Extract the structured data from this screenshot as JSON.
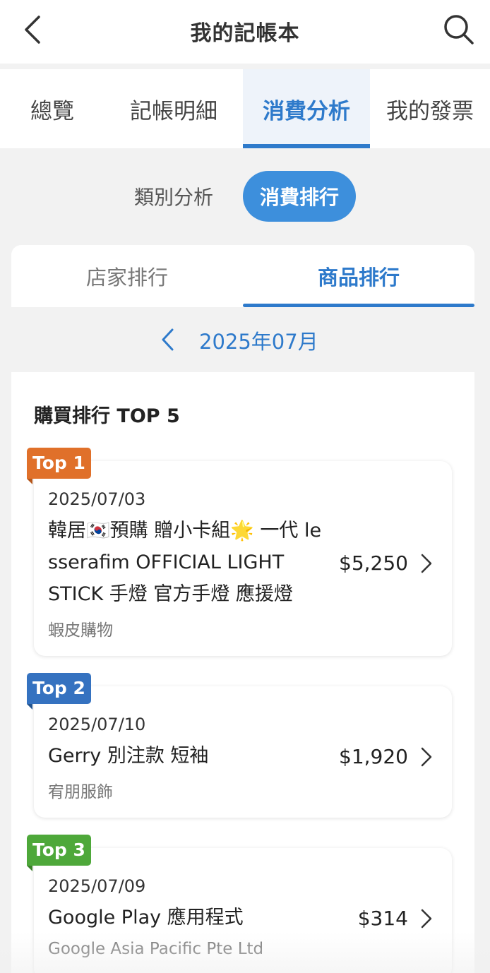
{
  "header": {
    "title": "我的記帳本",
    "back_icon": "chevron-left-icon",
    "search_icon": "search-icon"
  },
  "main_tabs": [
    {
      "label": "總覽",
      "active": false
    },
    {
      "label": "記帳明細",
      "active": false
    },
    {
      "label": "消費分析",
      "active": true
    },
    {
      "label": "我的發票",
      "active": false
    }
  ],
  "segment": {
    "category_label": "類別分析",
    "ranking_label": "消費排行",
    "active": "消費排行"
  },
  "sub_tabs": [
    {
      "label": "店家排行",
      "active": false
    },
    {
      "label": "商品排行",
      "active": true
    }
  ],
  "month": {
    "label": "2025年07月",
    "prev_icon": "chevron-left-icon"
  },
  "ranking": {
    "title": "購買排行 TOP 5",
    "items": [
      {
        "badge": "Top 1",
        "badge_color": "#e0702a",
        "date": "2025/07/03",
        "name": "韓居🇰🇷預購 贈小卡組🌟 一代 le sserafim OFFICIAL LIGHT STICK 手燈 官方手燈 應援燈",
        "store": "蝦皮購物",
        "amount": "$5,250"
      },
      {
        "badge": "Top 2",
        "badge_color": "#3572c0",
        "date": "2025/07/10",
        "name": "Gerry 別注款 短袖",
        "store": "宥朋服飾",
        "amount": "$1,920"
      },
      {
        "badge": "Top 3",
        "badge_color": "#4ea83a",
        "date": "2025/07/09",
        "name": "Google Play 應用程式",
        "store": "Google Asia Pacific Pte Ltd",
        "amount": "$314"
      }
    ]
  },
  "colors": {
    "accent": "#2e7acb",
    "segment_active": "#3d8fdc",
    "background": "#f2f2f2"
  }
}
